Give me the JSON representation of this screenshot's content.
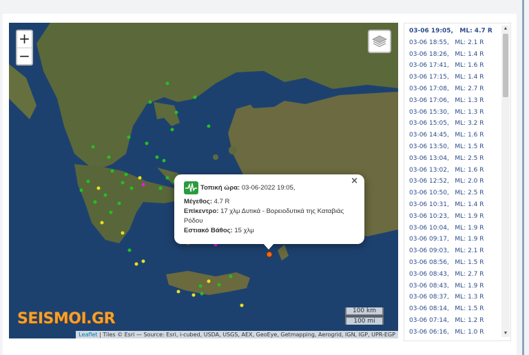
{
  "map": {
    "zoom_in_label": "+",
    "zoom_out_label": "−",
    "layers_icon": "layers-icon",
    "scale_km": "100 km",
    "scale_mi": "100 mi",
    "attribution_link": "Leaflet",
    "attribution_text": " | Tiles © Esri — Source: Esri, i-cubed, USDA, USGS, AEX, GeoEye, Getmapping, Aerogrid, IGN, IGP, UPR-EGP",
    "logo_text": "SEISMOI.GR",
    "colors": {
      "sea": "#1c3f6e",
      "land": "#5f6b3c",
      "green_marker": "#22c022",
      "yellow_marker": "#e8e020",
      "highlight_marker": "#f06a1c",
      "magenta_marker": "#e020e0"
    }
  },
  "popup": {
    "icon": "seismograph-icon",
    "time_label": "Τοπική ώρα:",
    "time_value": " 03-06-2022 19:05,",
    "magnitude_label": "Μέγεθος:",
    "magnitude_value": " 4.7 R",
    "epicenter_label": "Επίκεντρο:",
    "epicenter_value": " 17 χλμ Δυτικά - Βορειοδυτικά της Καταβιάς Ρόδου",
    "depth_label": "Εστιακό Βάθος:",
    "depth_value": " 15 χλμ",
    "close_label": "×"
  },
  "events": [
    "03-06 19:05,   ML: 4.7 R",
    "03-06 18:55,   ML: 2.1 R",
    "03-06 18:26,   ML: 1.4 R",
    "03-06 17:41,   ML: 1.6 R",
    "03-06 17:15,   ML: 1.4 R",
    "03-06 17:08,   ML: 2.7 R",
    "03-06 17:06,   ML: 1.3 R",
    "03-06 15:30,   ML: 1.3 R",
    "03-06 15:05,   ML: 3.2 R",
    "03-06 14:45,   ML: 1.6 R",
    "03-06 13:50,   ML: 1.5 R",
    "03-06 13:04,   ML: 2.5 R",
    "03-06 13:02,   ML: 1.6 R",
    "03-06 12:52,   ML: 2.0 R",
    "03-06 10:50,   ML: 2.5 R",
    "03-06 10:31,   ML: 1.4 R",
    "03-06 10:23,   ML: 1.9 R",
    "03-06 10:04,   ML: 1.9 R",
    "03-06 09:17,   ML: 1.9 R",
    "03-06 09:03,   ML: 2.1 R",
    "03-06 08:56,   ML: 1.5 R",
    "03-06 08:43,   ML: 2.7 R",
    "03-06 08:43,   ML: 1.9 R",
    "03-06 08:37,   ML: 1.3 R",
    "03-06 08:14,   ML: 1.5 R",
    "03-06 07:14,   ML: 1.2 R",
    "03-06 06:16,   ML: 1.0 R"
  ],
  "scrollbar": {
    "up": "▲",
    "down": "▼"
  }
}
